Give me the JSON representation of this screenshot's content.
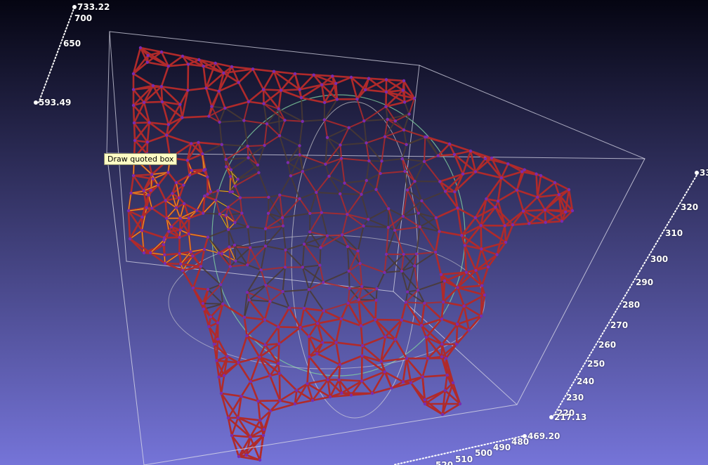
{
  "tooltip": {
    "text": "Draw quoted box"
  },
  "axes": {
    "z": {
      "max_label": "733.22",
      "min_label": "593.49",
      "ticks": [
        "700",
        "650"
      ]
    },
    "y": {
      "max_label": "33",
      "min_label": "217.13",
      "ticks": [
        "320",
        "310",
        "300",
        "290",
        "280",
        "270",
        "260",
        "250",
        "240",
        "230",
        "220"
      ]
    },
    "x": {
      "max_label": "469.20",
      "ticks": [
        "480",
        "490",
        "500",
        "510",
        "520"
      ]
    }
  },
  "colors": {
    "background_top": "#050512",
    "background_bottom": "#7574d8",
    "mesh_edge": "#b02a2a",
    "mesh_edge_dark": "#4a3a32",
    "mesh_vertex": "#7a2ab0",
    "highlight_edge": "#f0c020",
    "bounding_box": "#d8d8e8",
    "trackball_green": "#7fd0a0",
    "trackball_white": "#dddddd",
    "axis_dots": "#ffffff"
  }
}
